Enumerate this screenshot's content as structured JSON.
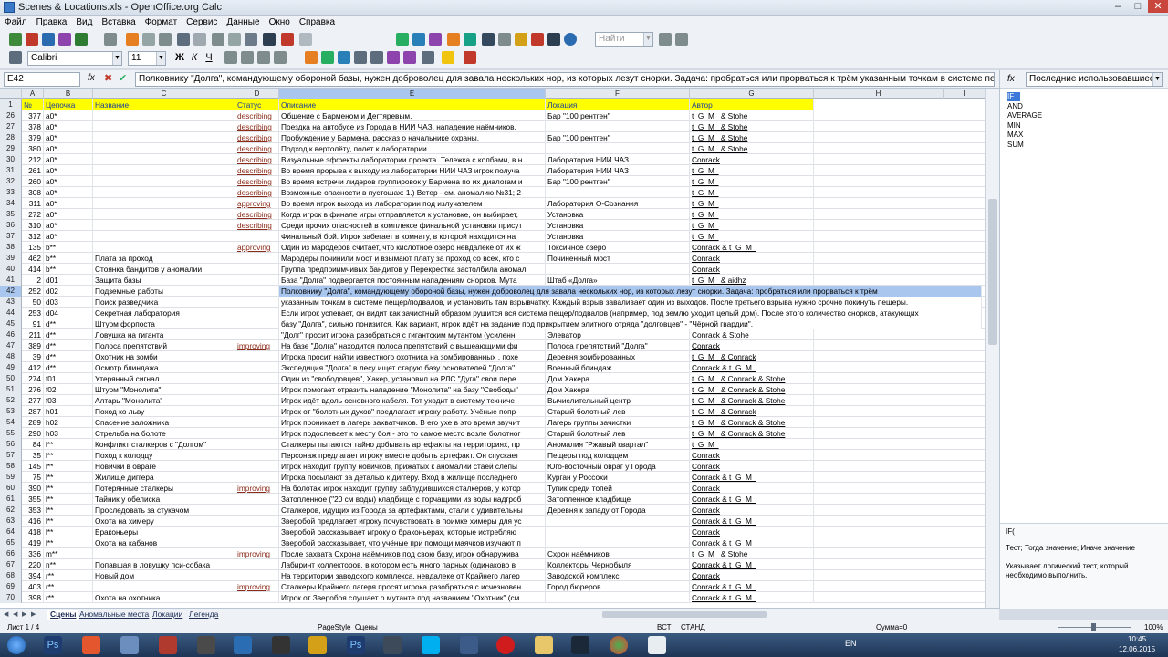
{
  "window": {
    "title": "Scenes & Locations.xls - OpenOffice.org Calc"
  },
  "menu": [
    "Файл",
    "Правка",
    "Вид",
    "Вставка",
    "Формат",
    "Сервис",
    "Данные",
    "Окно",
    "Справка"
  ],
  "toolbar": {
    "find_placeholder": "Найти",
    "font_name": "Calibri",
    "font_size": "11"
  },
  "formula_bar": {
    "cell_ref": "E42",
    "content": "Полковнику \"Долга\", командующему обороной базы, нужен доброволец для завала нескольких нор, из которых лезут снорки. Задача: пробраться или прорваться к трём указанным точкам в системе пещер/подвалов, и установить там взрывчатку. Каж"
  },
  "columns": [
    "A",
    "B",
    "C",
    "D",
    "E",
    "F",
    "G",
    "H",
    "I"
  ],
  "header_row": {
    "num": "1",
    "cells": [
      "№",
      "Цепочка",
      "Название",
      "Статус",
      "Описание",
      "Локация",
      "Автор"
    ]
  },
  "rows": [
    {
      "r": "26",
      "a": "377",
      "b": "a0*",
      "c": "",
      "d": "describing",
      "e": "Общение с Барменом и Дегтяревым.",
      "f": "Бар \"100 рентген\"",
      "g": "t_G_M_ & Stohe"
    },
    {
      "r": "27",
      "a": "378",
      "b": "a0*",
      "c": "",
      "d": "describing",
      "e": "Поездка на автобусе из Города в НИИ ЧАЗ, нападение наёмников.",
      "f": "",
      "g": "t_G_M_ & Stohe"
    },
    {
      "r": "28",
      "a": "379",
      "b": "a0*",
      "c": "",
      "d": "describing",
      "e": "Пробуждение у Бармена, рассказ о начальнике охраны.",
      "f": "Бар \"100 рентген\"",
      "g": "t_G_M_ & Stohe"
    },
    {
      "r": "29",
      "a": "380",
      "b": "a0*",
      "c": "",
      "d": "describing",
      "e": "Подход к вертолёту, полет к лаборатории.",
      "f": "",
      "g": "t_G_M_ & Stohe"
    },
    {
      "r": "30",
      "a": "212",
      "b": "a0*",
      "c": "",
      "d": "describing",
      "e": "Визуальные эффекты лаборатории проекта. Тележка с колбами, в н",
      "f": "Лаборатория НИИ ЧАЗ",
      "g": "Conrack"
    },
    {
      "r": "31",
      "a": "261",
      "b": "a0*",
      "c": "",
      "d": "describing",
      "e": "Во время прорыва к выходу из лаборатории НИИ ЧАЗ игрок получа",
      "f": "Лаборатория НИИ ЧАЗ",
      "g": "t_G_M_"
    },
    {
      "r": "32",
      "a": "260",
      "b": "a0*",
      "c": "",
      "d": "describing",
      "e": "Во время встречи лидеров группировок у Бармена по их диалогам и",
      "f": "Бар \"100 рентген\"",
      "g": "t_G_M_"
    },
    {
      "r": "33",
      "a": "308",
      "b": "a0*",
      "c": "",
      "d": "describing",
      "e": "Возможные опасности в пустошах: 1.) Ветер - см. аномалию №31; 2",
      "f": "",
      "g": "t_G_M_"
    },
    {
      "r": "34",
      "a": "311",
      "b": "a0*",
      "c": "",
      "d": "approving",
      "e": "Во время игрок выхода из лаборатории под излучателем",
      "f": "Лаборатория О-Сознания",
      "g": "t_G_M_"
    },
    {
      "r": "35",
      "a": "272",
      "b": "a0*",
      "c": "",
      "d": "describing",
      "e": "Когда игрок в финале игры отправляется к установке, он выбирает,",
      "f": "Установка",
      "g": "t_G_M_"
    },
    {
      "r": "36",
      "a": "310",
      "b": "a0*",
      "c": "",
      "d": "describing",
      "e": "Среди прочих опасностей в комплексе финальной установки присут",
      "f": "Установка",
      "g": "t_G_M_"
    },
    {
      "r": "37",
      "a": "312",
      "b": "a0*",
      "c": "",
      "d": "",
      "e": "Финальный бой. Игрок забегает в комнату, в которой находится на",
      "f": "Установка",
      "g": "t_G_M_"
    },
    {
      "r": "38",
      "a": "135",
      "b": "b**",
      "c": "",
      "d": "approving",
      "e": "Один из мародеров считает, что кислотное озеро невдалеке от их ж",
      "f": "Токсичное озеро",
      "g": "Conrack & t_G_M_"
    },
    {
      "r": "39",
      "a": "462",
      "b": "b**",
      "c": "Плата за проход",
      "d": "",
      "e": "Мародеры починили мост и взымают плату за проход со всех, кто с",
      "f": "Починенный мост",
      "g": "Conrack"
    },
    {
      "r": "40",
      "a": "414",
      "b": "b**",
      "c": "Стоянка бандитов у аномалии",
      "d": "",
      "e": "Группа предприимчивых бандитов у Перекрестка застолбила аномал",
      "f": "",
      "g": "Conrack"
    },
    {
      "r": "41",
      "a": "2",
      "b": "d01",
      "c": "Защита базы",
      "d": "",
      "e": "База \"Долга\" подвергается постоянным нападениям снорков. Мута",
      "f": "Штаб «Долга»",
      "g": "t_G_M_ & aidhz"
    },
    {
      "r": "42",
      "a": "252",
      "b": "d02",
      "c": "Подземные работы",
      "d": "",
      "e": "Полковнику \"Долга\", командующему обороной базы, нужен доброволец для завала нескольких нор, из которых лезут снорки. Задача: пробраться или прорваться к трём",
      "f": "",
      "g": "",
      "wide": true,
      "sel": true
    },
    {
      "r": "43",
      "a": "50",
      "b": "d03",
      "c": "Поиск разведчика",
      "d": "",
      "e": "указанным точкам в системе пещер/подвалов, и установить там взрывчатку. Каждый взрыв заваливает один из выходов. После третьего взрыва нужно срочно покинуть пещеры.",
      "f": "",
      "g": "",
      "wide": true
    },
    {
      "r": "44",
      "a": "253",
      "b": "d04",
      "c": "Секретная лаборатория",
      "d": "",
      "e": "Если игрок успевает, он видит как зачистный образом рушится вся система пещер/подвалов (например, под землю уходит целый дом). После этого количество снорков, атакующих",
      "f": "",
      "g": "",
      "wide": true
    },
    {
      "r": "45",
      "a": "91",
      "b": "d**",
      "c": "Штурм форпоста",
      "d": "",
      "e": "базу \"Долга\", сильно понизится. Как вариант, игрок идёт на задание под прикрытием элитного отряда \"долговцев\" - \"Чёрной гвардии\".",
      "f": "",
      "g": "",
      "wide": true
    },
    {
      "r": "46",
      "a": "211",
      "b": "d**",
      "c": "Ловушка на гиганта",
      "d": "",
      "e": "\"Долг\" просит игрока разобраться с гигантским мутантом (усиленн",
      "f": "Элеватор",
      "g": "Conrack & Stohe"
    },
    {
      "r": "47",
      "a": "389",
      "b": "d**",
      "c": "Полоса препятствий",
      "d": "improving",
      "e": "На базе \"Долга\" находится полоса препятствий с вышеающими фи",
      "f": "Полоса препятствий \"Долга\"",
      "g": "Conrack"
    },
    {
      "r": "48",
      "a": "39",
      "b": "d**",
      "c": "Охотник на зомби",
      "d": "",
      "e": "Игрока просит найти известного охотника на зомбированных , похе",
      "f": "Деревня зомбированных",
      "g": "t_G_M_ & Conrack"
    },
    {
      "r": "49",
      "a": "412",
      "b": "d**",
      "c": "Осмотр блиндажа",
      "d": "",
      "e": "Экспедиция \"Долга\" в лесу ищет старую базу основателей \"Долга\".",
      "f": "Военный блиндаж",
      "g": "Conrack & t_G_M_"
    },
    {
      "r": "50",
      "a": "274",
      "b": "f01",
      "c": "Утерянный сигнал",
      "d": "",
      "e": "Один из \"свободовцев\", Хакер, установил на РЛС \"Дуга\" свои пере",
      "f": "Дом Хакера",
      "g": "t_G_M_ & Conrack & Stohe"
    },
    {
      "r": "51",
      "a": "276",
      "b": "f02",
      "c": "Штурм \"Монолита\"",
      "d": "",
      "e": "Игрок помогает отразить нападение \"Монолита\" на базу \"Свободы\"",
      "f": "Дом Хакера",
      "g": "t_G_M_ & Conrack & Stohe"
    },
    {
      "r": "52",
      "a": "277",
      "b": "f03",
      "c": "Алтарь \"Монолита\"",
      "d": "",
      "e": "Игрок идёт вдоль основного кабеля. Тот уходит в систему техниче",
      "f": "Вычислительный центр",
      "g": "t_G_M_ & Conrack & Stohe"
    },
    {
      "r": "53",
      "a": "287",
      "b": "h01",
      "c": "Поход ко льву",
      "d": "",
      "e": "Игрок от \"болотных духов\" предлагает игроку работу. Учёные попр",
      "f": "Старый болотный лев",
      "g": "t_G_M_ & Conrack"
    },
    {
      "r": "54",
      "a": "289",
      "b": "h02",
      "c": "Спасение заложника",
      "d": "",
      "e": "Игрок проникает в лагерь захватчиков. В его ухе в это время звучит",
      "f": "Лагерь группы зачистки",
      "g": "t_G_M_ & Conrack & Stohe"
    },
    {
      "r": "55",
      "a": "290",
      "b": "h03",
      "c": "Стрельба на болоте",
      "d": "",
      "e": "Игрок подоспевает к месту боя - это то самое место возле болотног",
      "f": "Старый болотный лев",
      "g": "t_G_M_ & Conrack & Stohe"
    },
    {
      "r": "56",
      "a": "84",
      "b": "l**",
      "c": "Конфликт сталкеров с \"Долгом\"",
      "d": "",
      "e": "Сталкеры пытаются тайно добывать артефакты на территориях, пр",
      "f": "Аномалия \"Ржавый квартал\"",
      "g": "t_G_M_"
    },
    {
      "r": "57",
      "a": "35",
      "b": "l**",
      "c": "Поход к колодцу",
      "d": "",
      "e": "Персонаж предлагает игроку вместе добыть артефакт. Он спускает",
      "f": "Пещеры под колодцем",
      "g": "Conrack"
    },
    {
      "r": "58",
      "a": "145",
      "b": "l**",
      "c": "Новички в овраге",
      "d": "",
      "e": "Игрок находит группу новичков, прижатых к аномалии стаей слепы",
      "f": "Юго-восточный овраг у Города",
      "g": "Conrack"
    },
    {
      "r": "59",
      "a": "75",
      "b": "l**",
      "c": "Жилище диггера",
      "d": "",
      "e": "Игрока посылают за деталью к диггеру. Вход в жилище последнего",
      "f": "Курган у Россохи",
      "g": "Conrack & t_G_M_"
    },
    {
      "r": "60",
      "a": "390",
      "b": "l**",
      "c": "Потерянные сталкеры",
      "d": "improving",
      "e": "На болотах игрок находит группу заблудившихся сталкеров, у котор",
      "f": "Тупик среди топей",
      "g": "Conrack"
    },
    {
      "r": "61",
      "a": "355",
      "b": "l**",
      "c": "Тайник у обелиска",
      "d": "",
      "e": "Затопленное (\"20 см воды) кладбище с торчащими из воды надгроб",
      "f": "Затопленное кладбище",
      "g": "Conrack & t_G_M_"
    },
    {
      "r": "62",
      "a": "353",
      "b": "l**",
      "c": "Проследовать за стукачом",
      "d": "",
      "e": "Сталкеров, идущих из Города за артефактами, стали с удивительны",
      "f": "Деревня к западу от Города",
      "g": "Conrack"
    },
    {
      "r": "63",
      "a": "416",
      "b": "l**",
      "c": "Охота на химеру",
      "d": "",
      "e": "Зверобой предлагает игроку почувствовать в поимке химеры для ус",
      "f": "",
      "g": "Conrack & t_G_M_"
    },
    {
      "r": "64",
      "a": "418",
      "b": "l**",
      "c": "Браконьеры",
      "d": "",
      "e": "Зверобой рассказывает игроку о браконьерах, которые истребляю",
      "f": "",
      "g": "Conrack"
    },
    {
      "r": "65",
      "a": "419",
      "b": "l**",
      "c": "Охота на кабанов",
      "d": "",
      "e": "Зверобой рассказывает, что учёные при помощи маячков изучают п",
      "f": "",
      "g": "Conrack & t_G_M_"
    },
    {
      "r": "66",
      "a": "336",
      "b": "m**",
      "c": "",
      "d": "improving",
      "e": "После захвата Схрона наёмников под свою базу, игрок обнаружива",
      "f": "Схрон наёмников",
      "g": "t_G_M_ & Stohe"
    },
    {
      "r": "67",
      "a": "220",
      "b": "n**",
      "c": "Попавшая в ловушку пси-собака",
      "d": "",
      "e": "Лабиринт коллекторов, в котором есть много парных (одинаково в",
      "f": "Коллекторы Чернобыля",
      "g": "Conrack & t_G_M_"
    },
    {
      "r": "68",
      "a": "394",
      "b": "r**",
      "c": "Новый дом",
      "d": "",
      "e": "На территории заводского комплекса, невдалеке от Крайнего лагер",
      "f": "Заводской комплекс",
      "g": "Conrack"
    },
    {
      "r": "69",
      "a": "403",
      "b": "r**",
      "c": "",
      "d": "improving",
      "e": "Сталкеры Крайнего лагеря просят игрока разобраться с исчезновен",
      "f": "Город бюреров",
      "g": "Conrack & t_G_M_"
    },
    {
      "r": "70",
      "a": "398",
      "b": "r**",
      "c": "Охота на охотника",
      "d": "",
      "e": "Игрок от Зверобоя слушает о мутанте под названием \"Охотник\" (см.",
      "f": "",
      "g": "Conrack & t_G_M_"
    }
  ],
  "sidebar": {
    "category": "Последние использовавшиеся",
    "functions": [
      "IF",
      "AND",
      "AVERAGE",
      "MIN",
      "MAX",
      "SUM"
    ],
    "syntax": "IF(",
    "args": "Тест; Тогда значение; Иначе значение",
    "desc": "Указывает логический тест, который необходимо выполнить."
  },
  "sheet_tabs": [
    "Сцены",
    "Аномальные места",
    "Локации",
    "Легенда"
  ],
  "status": {
    "sheet": "Лист 1 / 4",
    "style": "PageStyle_Сцены",
    "mode": "ВСТ",
    "std": "СТАНД",
    "sum": "Сумма=0",
    "zoom": "100%"
  },
  "taskbar": {
    "lang": "EN",
    "time": "10:45",
    "date": "12.06.2015"
  }
}
